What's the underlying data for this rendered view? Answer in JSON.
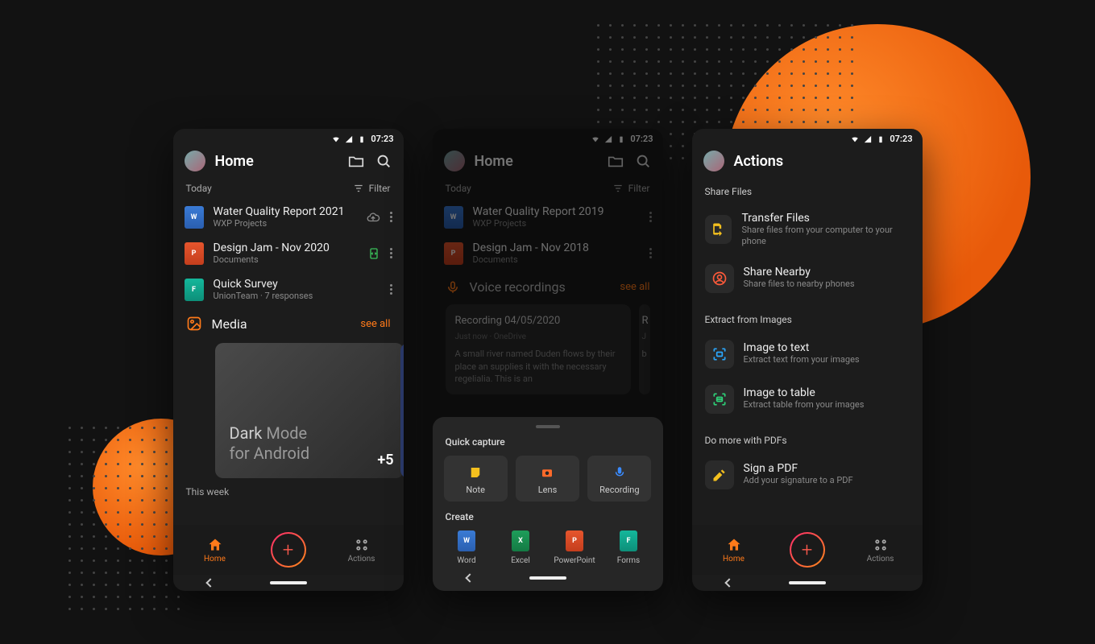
{
  "status_time": "07:23",
  "screens": {
    "home": {
      "title": "Home",
      "today_label": "Today",
      "filter_label": "Filter",
      "files": [
        {
          "title": "Water Quality Report 2021",
          "sub": "WXP Projects",
          "type": "word",
          "tail": "cloud"
        },
        {
          "title": "Design Jam - Nov 2020",
          "sub": "Documents",
          "type": "ppt",
          "tail": "sync"
        },
        {
          "title": "Quick Survey",
          "sub": "UnionTeam · 7 responses",
          "type": "forms",
          "tail": ""
        }
      ],
      "media_label": "Media",
      "see_all": "see all",
      "media_card_line1": "Dark",
      "media_card_line1b": " Mode",
      "media_card_line2": "for Android",
      "media_plus": "+5",
      "this_week": "This week",
      "nav_home": "Home",
      "nav_actions": "Actions"
    },
    "home_dim": {
      "title": "Home",
      "today_label": "Today",
      "filter_label": "Filter",
      "files": [
        {
          "title": "Water Quality Report 2019",
          "sub": "WXP Projects",
          "type": "word"
        },
        {
          "title": "Design Jam - Nov 2018",
          "sub": "Documents",
          "type": "ppt"
        }
      ],
      "voice_label": "Voice recordings",
      "see_all": "see all",
      "recording": {
        "title": "Recording 04/05/2020",
        "sub": "Just now · OneDrive",
        "body": "A small  river named Duden flows by their place an  supplies it with the necessary regelialia. This is an"
      },
      "recording2": {
        "title_initial": "R",
        "sub_initial": "J",
        "body_initial": "b"
      }
    },
    "sheet": {
      "quick_capture": "Quick capture",
      "items": [
        {
          "label": "Note",
          "color": "#f4c01e"
        },
        {
          "label": "Lens",
          "color": "#ff6a2a"
        },
        {
          "label": "Recording",
          "color": "#3a8bff"
        }
      ],
      "create_label": "Create",
      "create": [
        {
          "label": "Word",
          "type": "word"
        },
        {
          "label": "Excel",
          "type": "excel"
        },
        {
          "label": "PowerPoint",
          "type": "ppt"
        },
        {
          "label": "Forms",
          "type": "forms"
        }
      ]
    },
    "actions": {
      "title": "Actions",
      "share_label": "Share Files",
      "share_items": [
        {
          "title": "Transfer Files",
          "sub": "Share files from your computer to your phone",
          "color": "#f4c01e",
          "icon": "transfer"
        },
        {
          "title": "Share Nearby",
          "sub": "Share files to nearby phones",
          "color": "#ff5a3a",
          "icon": "person"
        }
      ],
      "extract_label": "Extract from Images",
      "extract_items": [
        {
          "title": "Image to text",
          "sub": "Extract text from your images",
          "color": "#2aa8ff",
          "icon": "scan-text"
        },
        {
          "title": "Image to table",
          "sub": "Extract table from your images",
          "color": "#2fd47a",
          "icon": "scan-table"
        }
      ],
      "pdf_label": "Do more with PDFs",
      "pdf_items": [
        {
          "title": "Sign a PDF",
          "sub": "Add your signature to a PDF",
          "color": "#f4c01e",
          "icon": "signature"
        }
      ],
      "nav_home": "Home",
      "nav_actions": "Actions"
    }
  }
}
